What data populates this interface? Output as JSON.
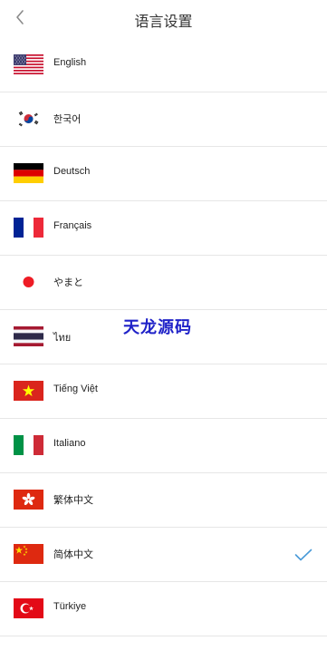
{
  "header": {
    "title": "语言设置"
  },
  "languages": [
    {
      "label": "English",
      "flag": "flag-us"
    },
    {
      "label": "한국어",
      "flag": "flag-kr"
    },
    {
      "label": "Deutsch",
      "flag": "flag-de"
    },
    {
      "label": "Français",
      "flag": "flag-fr"
    },
    {
      "label": "やまと",
      "flag": "flag-jp"
    },
    {
      "label": "ไทย",
      "flag": "flag-th"
    },
    {
      "label": "Tiếng Việt",
      "flag": "flag-vn"
    },
    {
      "label": "Italiano",
      "flag": "flag-it"
    },
    {
      "label": "繁体中文",
      "flag": "flag-hk"
    },
    {
      "label": "简体中文",
      "flag": "flag-cn",
      "selected": true
    },
    {
      "label": "Türkiye",
      "flag": "flag-tr"
    }
  ],
  "watermark": {
    "text": "天龙源码"
  },
  "colors": {
    "check": "#4a9bd8",
    "watermark": "#1f22c8"
  },
  "icons": {
    "back": "chevron-left-icon",
    "selected": "checkmark-icon"
  }
}
